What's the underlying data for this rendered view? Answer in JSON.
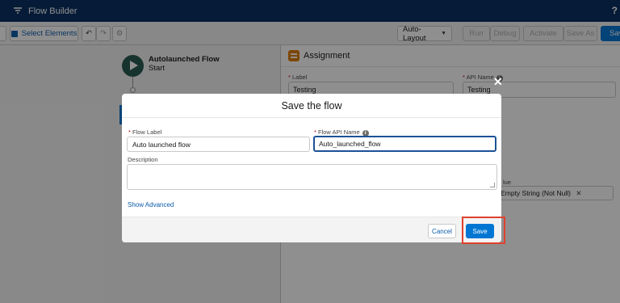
{
  "header": {
    "app_title": "Flow Builder",
    "help": "?"
  },
  "toolbar": {
    "select_elements": "Select Elements",
    "undo_icon": "↶",
    "redo_icon": "↷",
    "settings_icon": "⚙",
    "layout_mode": "Auto-Layout",
    "run": "Run",
    "debug": "Debug",
    "activate": "Activate",
    "save_as": "Save As",
    "save": "Save"
  },
  "canvas": {
    "flow_title": "Autolaunched Flow",
    "flow_subtitle": "Start"
  },
  "panel": {
    "title": "Assignment",
    "label_label": "Label",
    "label_value": "Testing",
    "api_name_label": "API Name",
    "api_name_value": "Testing",
    "value_label_partial": "lue",
    "value_pill": "g Empty String (Not Null)"
  },
  "modal": {
    "close_icon": "✕",
    "title": "Save the flow",
    "flow_label_label": "Flow Label",
    "flow_label_value": "Auto launched flow",
    "api_name_label": "Flow API Name",
    "api_name_value": "Auto_launched_flow",
    "description_label": "Description",
    "description_value": "",
    "show_advanced": "Show Advanced",
    "cancel": "Cancel",
    "save": "Save"
  },
  "colors": {
    "header_bg": "#032d60",
    "brand": "#0176d3",
    "start_icon": "#24584e",
    "assignment_icon": "#dd7a01",
    "highlight": "#e0412e"
  }
}
